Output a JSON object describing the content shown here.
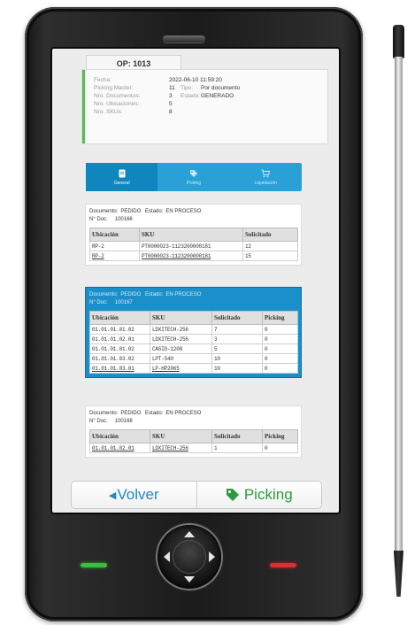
{
  "op_label": "OP: 1013",
  "info": {
    "fecha_label": "Fecha:",
    "fecha": "2022-06-10 11:59:20",
    "picking_master_label": "Picking Master:",
    "picking_master": "11",
    "tipo_label": "Tipo:",
    "tipo": "Por documento",
    "nro_documentos_label": "Nro. Documentos:",
    "nro_documentos": "3",
    "estado_label": "Estado:",
    "estado": "GENERADO",
    "nro_ubicaciones_label": "Nro. Ubicaciones:",
    "nro_ubicaciones": "5",
    "nro_skus_label": "Nro. SKUs:",
    "nro_skus": "8"
  },
  "tabs": [
    {
      "label": "General",
      "icon": "document-icon",
      "active": true
    },
    {
      "label": "Picking",
      "icon": "tag-icon",
      "active": false
    },
    {
      "label": "Liquidación",
      "icon": "cart-icon",
      "active": false
    }
  ],
  "documents": [
    {
      "documento_label": "Documento:",
      "documento": "PEDIDO",
      "estado_label": "Estado:",
      "estado": "EN PROCESO",
      "ndoc_label": "N° Doc:",
      "ndoc": "100166",
      "columns": [
        "Ubicación",
        "SKU",
        "",
        "Solicitado"
      ],
      "rows": [
        [
          "RP-2",
          "PT0000023-1123200000181",
          "",
          "12"
        ],
        [
          "RP-2",
          "PT0000023-1123200000181",
          "",
          "15"
        ]
      ]
    },
    {
      "documento_label": "Documento:",
      "documento": "PEDIDO",
      "estado_label": "Estado:",
      "estado": "EN PROCESO",
      "ndoc_label": "N° Doc:",
      "ndoc": "100167",
      "columns": [
        "Ubicación",
        "SKU",
        "Solicitado",
        "Picking"
      ],
      "rows": [
        [
          "01.01.01.01.02",
          "LDXITECH-256",
          "7",
          "0"
        ],
        [
          "01.01.01.02.01",
          "LDXITECH-256",
          "3",
          "0"
        ],
        [
          "01.01.01.01.02",
          "CASIO-1200",
          "5",
          "0"
        ],
        [
          "01.01.01.03.02",
          "LPT-540",
          "10",
          "0"
        ],
        [
          "01.01.01.03.01",
          "LP-HP2065",
          "10",
          "0"
        ]
      ]
    },
    {
      "documento_label": "Documento:",
      "documento": "PEDIDO",
      "estado_label": "Estado:",
      "estado": "EN PROCESO",
      "ndoc_label": "N° Doc:",
      "ndoc": "100168",
      "columns": [
        "Ubicación",
        "SKU",
        "Solicitado",
        "Picking"
      ],
      "rows": [
        [
          "01.01.01.02.01",
          "LDXITECH-256",
          "1",
          "0"
        ]
      ]
    }
  ],
  "buttons": {
    "back_label": "Volver",
    "picking_label": "Picking"
  },
  "colors": {
    "accent_blue": "#1b8fc9",
    "active_tab": "#0f86be",
    "green_bar": "#5cb85c",
    "picking_green": "#2e9a3e",
    "volver_blue": "#1f88c7"
  }
}
